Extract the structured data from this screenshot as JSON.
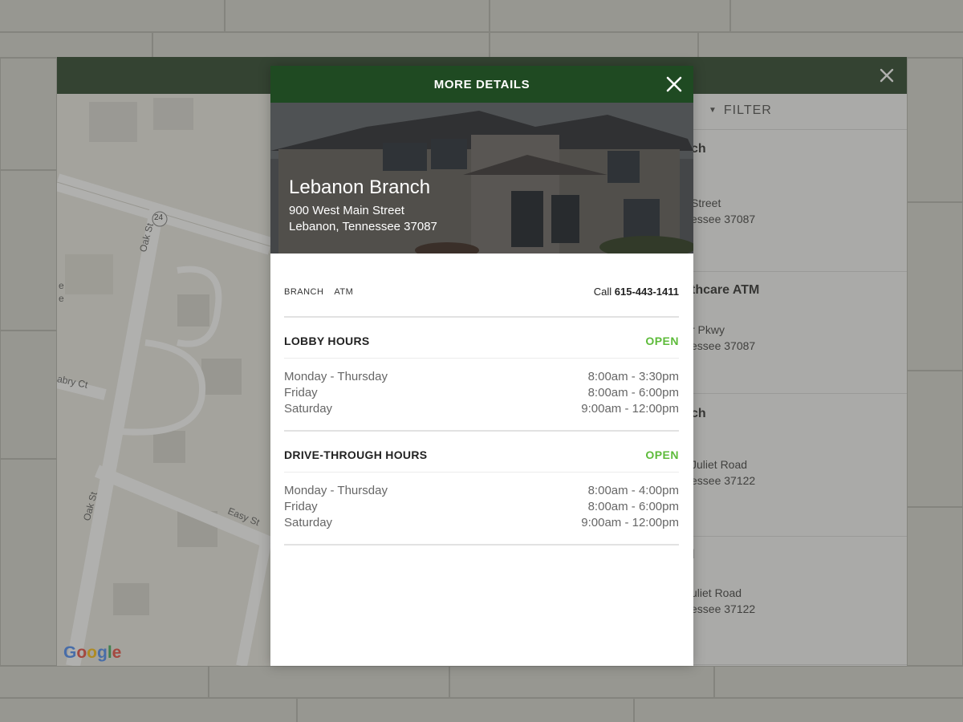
{
  "modal": {
    "title": "MORE DETAILS",
    "branch_name": "Lebanon Branch",
    "address_line1": "900 West Main Street",
    "address_line2": "Lebanon, Tennessee 37087",
    "tags": [
      "BRANCH",
      "ATM"
    ],
    "call_prefix": "Call",
    "phone": "615-443-1411",
    "sections": [
      {
        "title": "LOBBY HOURS",
        "status": "OPEN",
        "rows": [
          {
            "day": "Monday - Thursday",
            "time": "8:00am - 3:30pm"
          },
          {
            "day": "Friday",
            "time": "8:00am - 6:00pm"
          },
          {
            "day": "Saturday",
            "time": "9:00am - 12:00pm"
          }
        ]
      },
      {
        "title": "DRIVE-THROUGH HOURS",
        "status": "OPEN",
        "rows": [
          {
            "day": "Monday - Thursday",
            "time": "8:00am - 4:00pm"
          },
          {
            "day": "Friday",
            "time": "8:00am - 6:00pm"
          },
          {
            "day": "Saturday",
            "time": "9:00am - 12:00pm"
          }
        ]
      }
    ]
  },
  "list": {
    "filter_label": "FILTER",
    "items": [
      {
        "name": "ch",
        "line1": "Street",
        "line2": "essee 37087"
      },
      {
        "name": "thcare ATM",
        "line1": "r Pkwy",
        "line2": "essee 37087"
      },
      {
        "name": "ch",
        "line1": "Juliet Road",
        "line2": "essee 37122"
      },
      {
        "name": "l",
        "line1": "uliet Road",
        "line2": "essee 37122"
      }
    ]
  },
  "map": {
    "street_labels": [
      "Oak St",
      "abry Ct",
      "Oak St",
      "Easy St",
      "24",
      "e",
      "e"
    ],
    "attribution_logo": "Google"
  },
  "colors": {
    "header_green": "#1f4a22",
    "open_green": "#5dbb3a"
  },
  "icons": {
    "close": "close-icon",
    "filter_chevron": "chevron-down-icon"
  }
}
